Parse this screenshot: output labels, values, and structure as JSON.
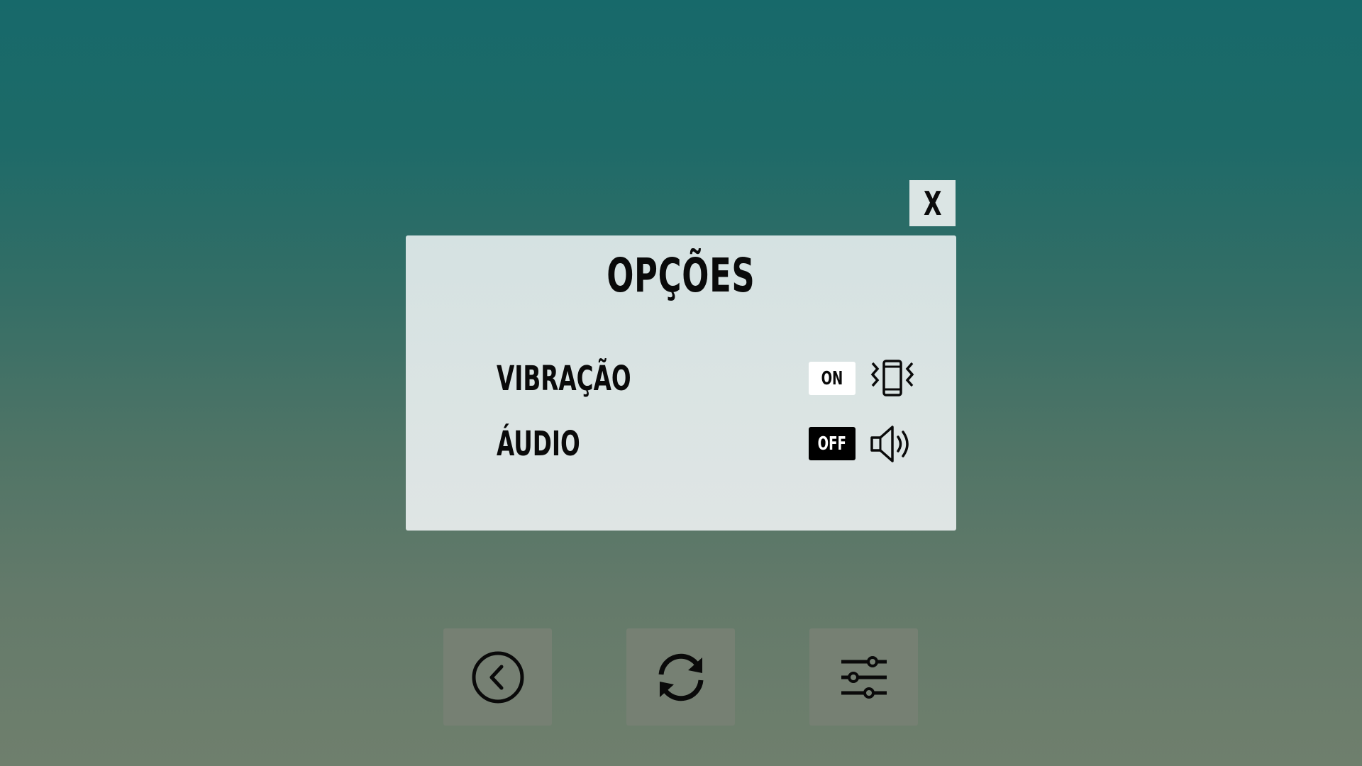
{
  "close_button": {
    "label": "X",
    "icon": "close-icon"
  },
  "dialog": {
    "title": "OPÇÕES",
    "options": [
      {
        "label": "VIBRAÇÃO",
        "toggle": "ON",
        "icon": "vibration-phone-icon"
      },
      {
        "label": "ÁUDIO",
        "toggle": "OFF",
        "icon": "speaker-icon"
      }
    ]
  },
  "bottom_bar": {
    "buttons": [
      {
        "name": "back",
        "icon": "chevron-left-circle-icon"
      },
      {
        "name": "restart",
        "icon": "refresh-icon"
      },
      {
        "name": "settings",
        "icon": "sliders-icon"
      }
    ]
  },
  "colors": {
    "background_top": "#17696a",
    "background_bottom": "#6f7f6d",
    "panel": "#dbe5e4",
    "toggle_on_bg": "#ffffff",
    "toggle_off_bg": "#000000",
    "bottom_button_bg": "#768073"
  }
}
